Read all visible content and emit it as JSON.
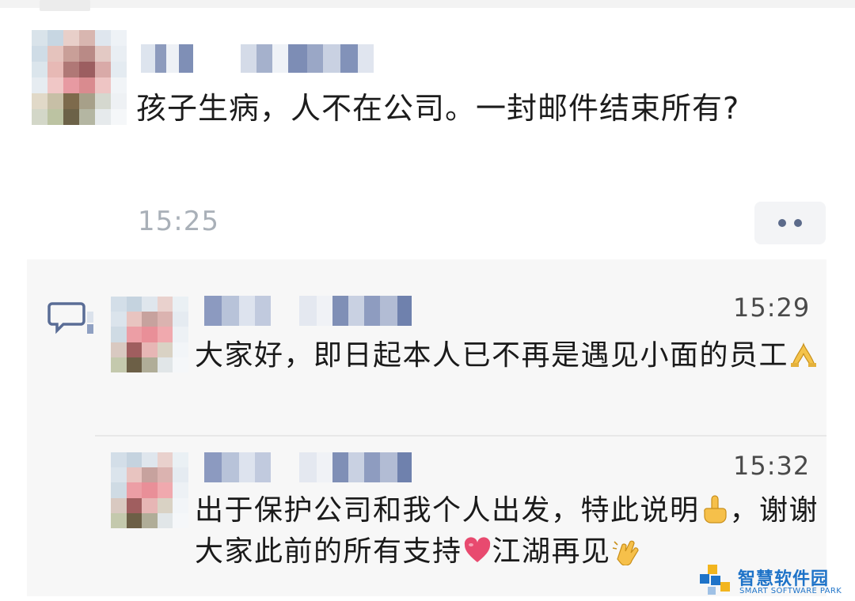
{
  "post": {
    "text": "孩子生病，人不在公司。一封邮件结束所有?",
    "time": "15:25",
    "more_icon": "more-dots-icon"
  },
  "comments": [
    {
      "time": "15:29",
      "text": "大家好，即日起本人已不再是遇见小面的员工",
      "emoji": "pray-hands-icon"
    },
    {
      "time": "15:32",
      "text_part1": "出于保护公司和我个人出发，特此说明",
      "text_part2": "，谢谢大家此前的所有支持",
      "text_part3": "江湖再见",
      "emojis": [
        "pointing-up-icon",
        "heart-icon",
        "waving-hands-icon"
      ]
    }
  ],
  "watermark": {
    "title": "智慧软件园",
    "subtitle": "SMART SOFTWARE PARK",
    "color": "#1e73c8"
  }
}
